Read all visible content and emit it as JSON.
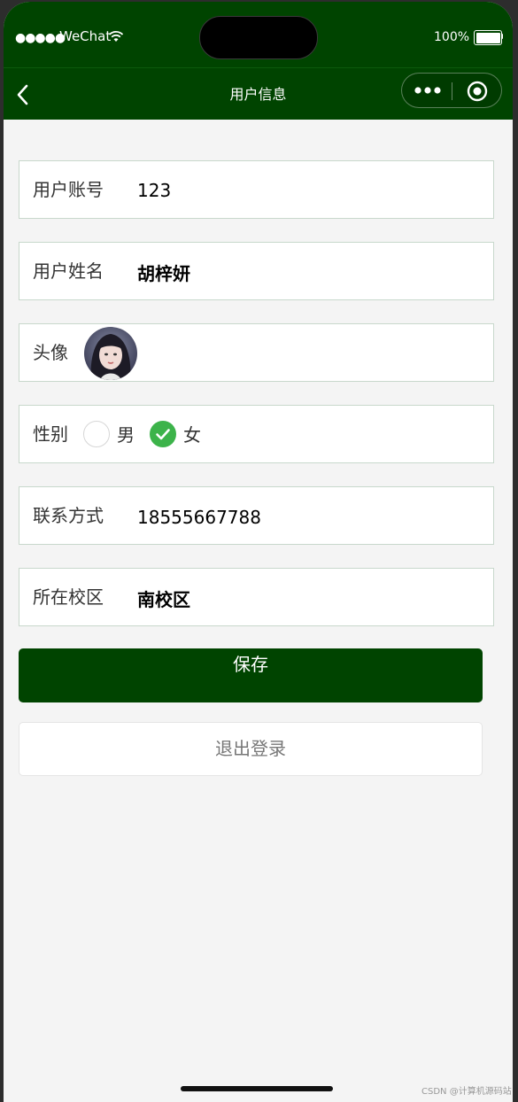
{
  "status_bar": {
    "signal": "●●●●●",
    "carrier": "WeChat",
    "battery_percent": "100%"
  },
  "nav": {
    "title": "用户信息"
  },
  "form": {
    "account": {
      "label": "用户账号",
      "value": "123"
    },
    "name": {
      "label": "用户姓名",
      "value": "胡梓妍"
    },
    "avatar": {
      "label": "头像"
    },
    "gender": {
      "label": "性别",
      "options": [
        "男",
        "女"
      ],
      "selected": "女"
    },
    "phone": {
      "label": "联系方式",
      "value": "18555667788"
    },
    "campus": {
      "label": "所在校区",
      "value": "南校区"
    }
  },
  "actions": {
    "save_label": "保存",
    "logout_label": "退出登录"
  },
  "watermark": "CSDN @计算机源码站",
  "colors": {
    "brand_green": "#004400",
    "radio_checked": "#3cb34a",
    "background": "#f4f4f4"
  },
  "icons": [
    "back-arrow-icon",
    "more-dots-icon",
    "record-target-icon",
    "wifi-icon",
    "battery-icon",
    "checkmark-icon"
  ]
}
